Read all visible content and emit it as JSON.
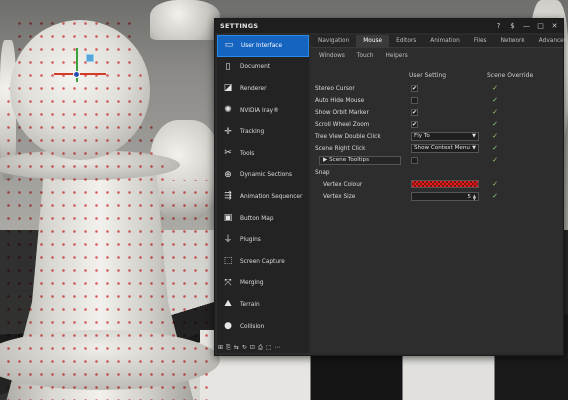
{
  "window": {
    "title": "SETTINGS",
    "controls": [
      "?",
      "$",
      "—",
      "□",
      "✕"
    ]
  },
  "sidebar": {
    "items": [
      {
        "label": "User Interface",
        "icon": "user-interface-icon",
        "glyph": "▭",
        "active": true
      },
      {
        "label": "Document",
        "icon": "document-icon",
        "glyph": "▯"
      },
      {
        "label": "Renderer",
        "icon": "renderer-icon",
        "glyph": "◪"
      },
      {
        "label": "NVIDIA Iray®",
        "icon": "nvidia-iray-icon",
        "glyph": "✺"
      },
      {
        "label": "Tracking",
        "icon": "tracking-icon",
        "glyph": "✛"
      },
      {
        "label": "Tools",
        "icon": "tools-icon",
        "glyph": "✂"
      },
      {
        "label": "Dynamic Sections",
        "icon": "dynamic-sections-icon",
        "glyph": "⊕"
      },
      {
        "label": "Animation Sequencer",
        "icon": "animation-sequencer-icon",
        "glyph": "⇶"
      },
      {
        "label": "Button Map",
        "icon": "button-map-icon",
        "glyph": "▣"
      },
      {
        "label": "Plugins",
        "icon": "plugins-icon",
        "glyph": "⏚"
      },
      {
        "label": "Screen Capture",
        "icon": "screen-capture-icon",
        "glyph": "⬚"
      },
      {
        "label": "Merging",
        "icon": "merging-icon",
        "glyph": "⤧"
      },
      {
        "label": "Terrain",
        "icon": "terrain-icon",
        "glyph": "⛰"
      },
      {
        "label": "Collision",
        "icon": "collision-icon",
        "glyph": "●"
      }
    ],
    "footer_icons": [
      "⊞",
      "⎘",
      "⇆",
      "↻",
      "⊡",
      "⎙",
      "⬚",
      "⋯"
    ]
  },
  "tabs": [
    "Navigation",
    "Mouse",
    "Editors",
    "Animation",
    "Files",
    "Network",
    "Advanced"
  ],
  "active_tab": "Mouse",
  "subtabs": [
    "Windows",
    "Touch",
    "Helpers"
  ],
  "headers": {
    "user_setting": "User Setting",
    "scene_override": "Scene Override"
  },
  "settings": {
    "stereo_cursor": {
      "label": "Stereo Cursor",
      "checked": "✔"
    },
    "auto_hide_mouse": {
      "label": "Auto Hide Mouse",
      "checked": ""
    },
    "show_orbit_marker": {
      "label": "Show Orbit Marker",
      "checked": "✔"
    },
    "scroll_wheel_zoom": {
      "label": "Scroll Wheel Zoom",
      "checked": "✔"
    },
    "tree_view_double_click": {
      "label": "Tree View Double Click",
      "value": "Fly To"
    },
    "scene_right_click": {
      "label": "Scene Right Click",
      "value": "Show Context Menu"
    },
    "scene_tooltips": {
      "label": "▶  Scene Tooltips",
      "checked": ""
    },
    "snap": {
      "label": "Snap"
    },
    "vertex_colour": {
      "label": "Vertex Colour",
      "color": "#e02020"
    },
    "vertex_size": {
      "label": "Vertex Size",
      "value": "5"
    }
  },
  "override_glyph": "✓"
}
